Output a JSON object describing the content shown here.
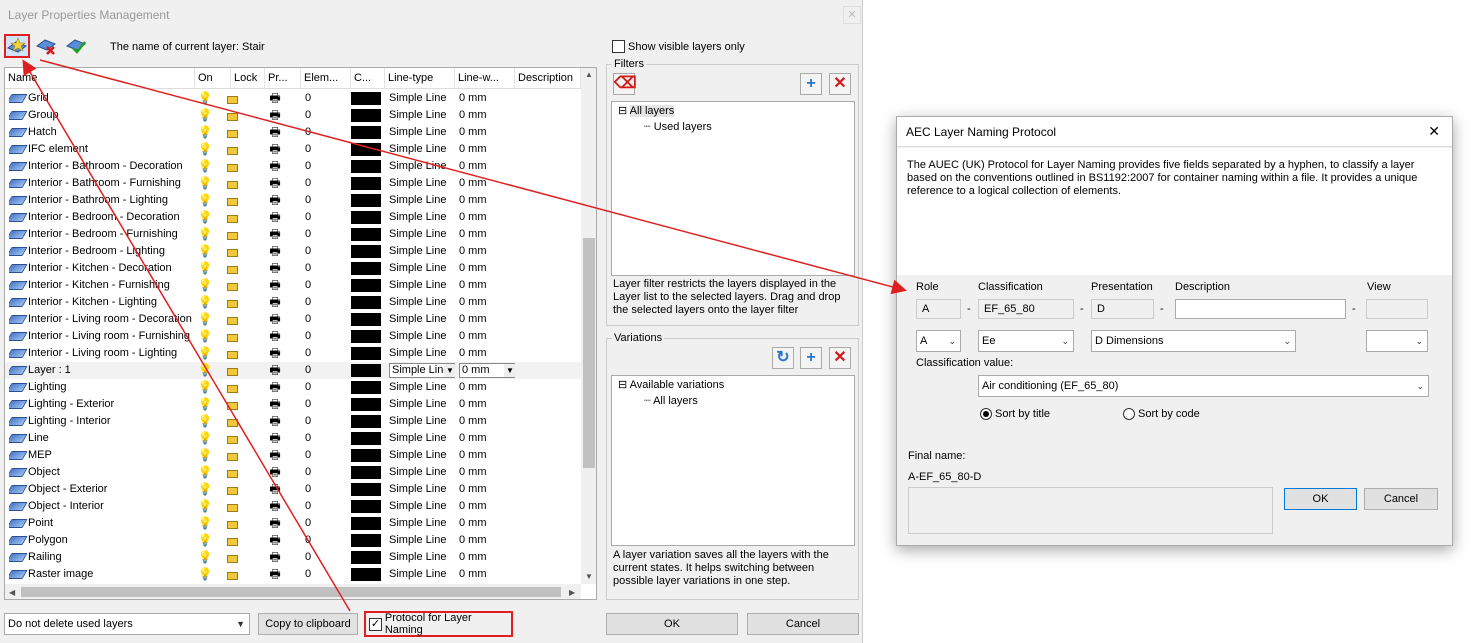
{
  "window": {
    "title": "Layer Properties Management"
  },
  "toolbar": {
    "current_layer_label": "The name of current layer: Stair"
  },
  "grid": {
    "columns": [
      "Name",
      "On",
      "Lock",
      "Pr...",
      "Elem...",
      "C...",
      "Line-type",
      "Line-w...",
      "Description"
    ],
    "rows": [
      {
        "name": "Grid",
        "elem": "0",
        "linetype": "Simple Line",
        "linew": "0 mm"
      },
      {
        "name": "Group",
        "elem": "0",
        "linetype": "Simple Line",
        "linew": "0 mm"
      },
      {
        "name": "Hatch",
        "elem": "0",
        "linetype": "Simple Line",
        "linew": "0 mm"
      },
      {
        "name": "IFC element",
        "elem": "0",
        "linetype": "Simple Line",
        "linew": "0 mm"
      },
      {
        "name": "Interior - Bathroom - Decoration",
        "elem": "0",
        "linetype": "Simple Line",
        "linew": "0 mm"
      },
      {
        "name": "Interior - Bathroom - Furnishing",
        "elem": "0",
        "linetype": "Simple Line",
        "linew": "0 mm"
      },
      {
        "name": "Interior - Bathroom - Lighting",
        "elem": "0",
        "linetype": "Simple Line",
        "linew": "0 mm"
      },
      {
        "name": "Interior - Bedroom - Decoration",
        "elem": "0",
        "linetype": "Simple Line",
        "linew": "0 mm"
      },
      {
        "name": "Interior - Bedroom - Furnishing",
        "elem": "0",
        "linetype": "Simple Line",
        "linew": "0 mm"
      },
      {
        "name": "Interior - Bedroom - Lighting",
        "elem": "0",
        "linetype": "Simple Line",
        "linew": "0 mm"
      },
      {
        "name": "Interior - Kitchen - Decoration",
        "elem": "0",
        "linetype": "Simple Line",
        "linew": "0 mm"
      },
      {
        "name": "Interior - Kitchen - Furnishing",
        "elem": "0",
        "linetype": "Simple Line",
        "linew": "0 mm"
      },
      {
        "name": "Interior - Kitchen - Lighting",
        "elem": "0",
        "linetype": "Simple Line",
        "linew": "0 mm"
      },
      {
        "name": "Interior - Living room - Decoration",
        "elem": "0",
        "linetype": "Simple Line",
        "linew": "0 mm"
      },
      {
        "name": "Interior - Living room - Furnishing",
        "elem": "0",
        "linetype": "Simple Line",
        "linew": "0 mm"
      },
      {
        "name": "Interior - Living room - Lighting",
        "elem": "0",
        "linetype": "Simple Line",
        "linew": "0 mm"
      },
      {
        "name": "Layer : 1",
        "elem": "0",
        "linetype": "Simple Line",
        "linew": "0 mm",
        "editing": true
      },
      {
        "name": "Lighting",
        "elem": "0",
        "linetype": "Simple Line",
        "linew": "0 mm"
      },
      {
        "name": "Lighting - Exterior",
        "elem": "0",
        "linetype": "Simple Line",
        "linew": "0 mm"
      },
      {
        "name": "Lighting - Interior",
        "elem": "0",
        "linetype": "Simple Line",
        "linew": "0 mm"
      },
      {
        "name": "Line",
        "elem": "0",
        "linetype": "Simple Line",
        "linew": "0 mm"
      },
      {
        "name": "MEP",
        "elem": "0",
        "linetype": "Simple Line",
        "linew": "0 mm"
      },
      {
        "name": "Object",
        "elem": "0",
        "linetype": "Simple Line",
        "linew": "0 mm"
      },
      {
        "name": "Object - Exterior",
        "elem": "0",
        "linetype": "Simple Line",
        "linew": "0 mm"
      },
      {
        "name": "Object - Interior",
        "elem": "0",
        "linetype": "Simple Line",
        "linew": "0 mm"
      },
      {
        "name": "Point",
        "elem": "0",
        "linetype": "Simple Line",
        "linew": "0 mm"
      },
      {
        "name": "Polygon",
        "elem": "0",
        "linetype": "Simple Line",
        "linew": "0 mm"
      },
      {
        "name": "Railing",
        "elem": "0",
        "linetype": "Simple Line",
        "linew": "0 mm"
      },
      {
        "name": "Raster image",
        "elem": "0",
        "linetype": "Simple Line",
        "linew": "0 mm"
      }
    ]
  },
  "side": {
    "show_visible_only": "Show visible layers only",
    "filters_label": "Filters",
    "filters_tree": [
      "All layers",
      "Used layers"
    ],
    "filters_help": "Layer filter restricts the layers displayed in the Layer list to the selected layers. Drag and drop the selected layers onto the layer filter",
    "variations_label": "Variations",
    "variations_tree": [
      "Available variations",
      "All layers"
    ],
    "variations_help": "A layer variation saves all the layers with the current states. It helps switching between possible layer variations in one step."
  },
  "footer": {
    "delete_option": "Do not delete used layers",
    "copy_button": "Copy to clipboard",
    "protocol_checkbox": "Protocol for Layer Naming",
    "ok": "OK",
    "cancel": "Cancel"
  },
  "aec": {
    "title": "AEC Layer Naming Protocol",
    "description": "The AUEC (UK) Protocol for Layer Naming provides five fields separated by a hyphen, to classify a layer based on the conventions outlined in BS1192:2007 for container naming within a file. It provides a unique reference to a logical collection of elements.",
    "labels": {
      "role": "Role",
      "classification": "Classification",
      "presentation": "Presentation",
      "description": "Description",
      "view": "View"
    },
    "values": {
      "role": "A",
      "classification": "EF_65_80",
      "presentation": "D",
      "description": "",
      "view": ""
    },
    "separator": "-",
    "selects": {
      "role": "A",
      "classification": "Ee",
      "presentation": "D Dimensions",
      "view": ""
    },
    "class_value_label": "Classification value:",
    "class_value": "Air conditioning (EF_65_80)",
    "sort_title": "Sort by title",
    "sort_code": "Sort by code",
    "final_name_label": "Final name:",
    "final_name": "A-EF_65_80-D",
    "ok": "OK",
    "cancel": "Cancel"
  },
  "colors": {
    "highlight_red": "#e02020",
    "swatch": "#000000",
    "ok_border": "#0078d7"
  },
  "icons": [
    "new-layer-icon",
    "delete-layer-icon",
    "apply-layer-icon",
    "bulb-icon",
    "lock-icon",
    "printer-icon",
    "add-icon",
    "remove-icon",
    "refresh-icon"
  ]
}
